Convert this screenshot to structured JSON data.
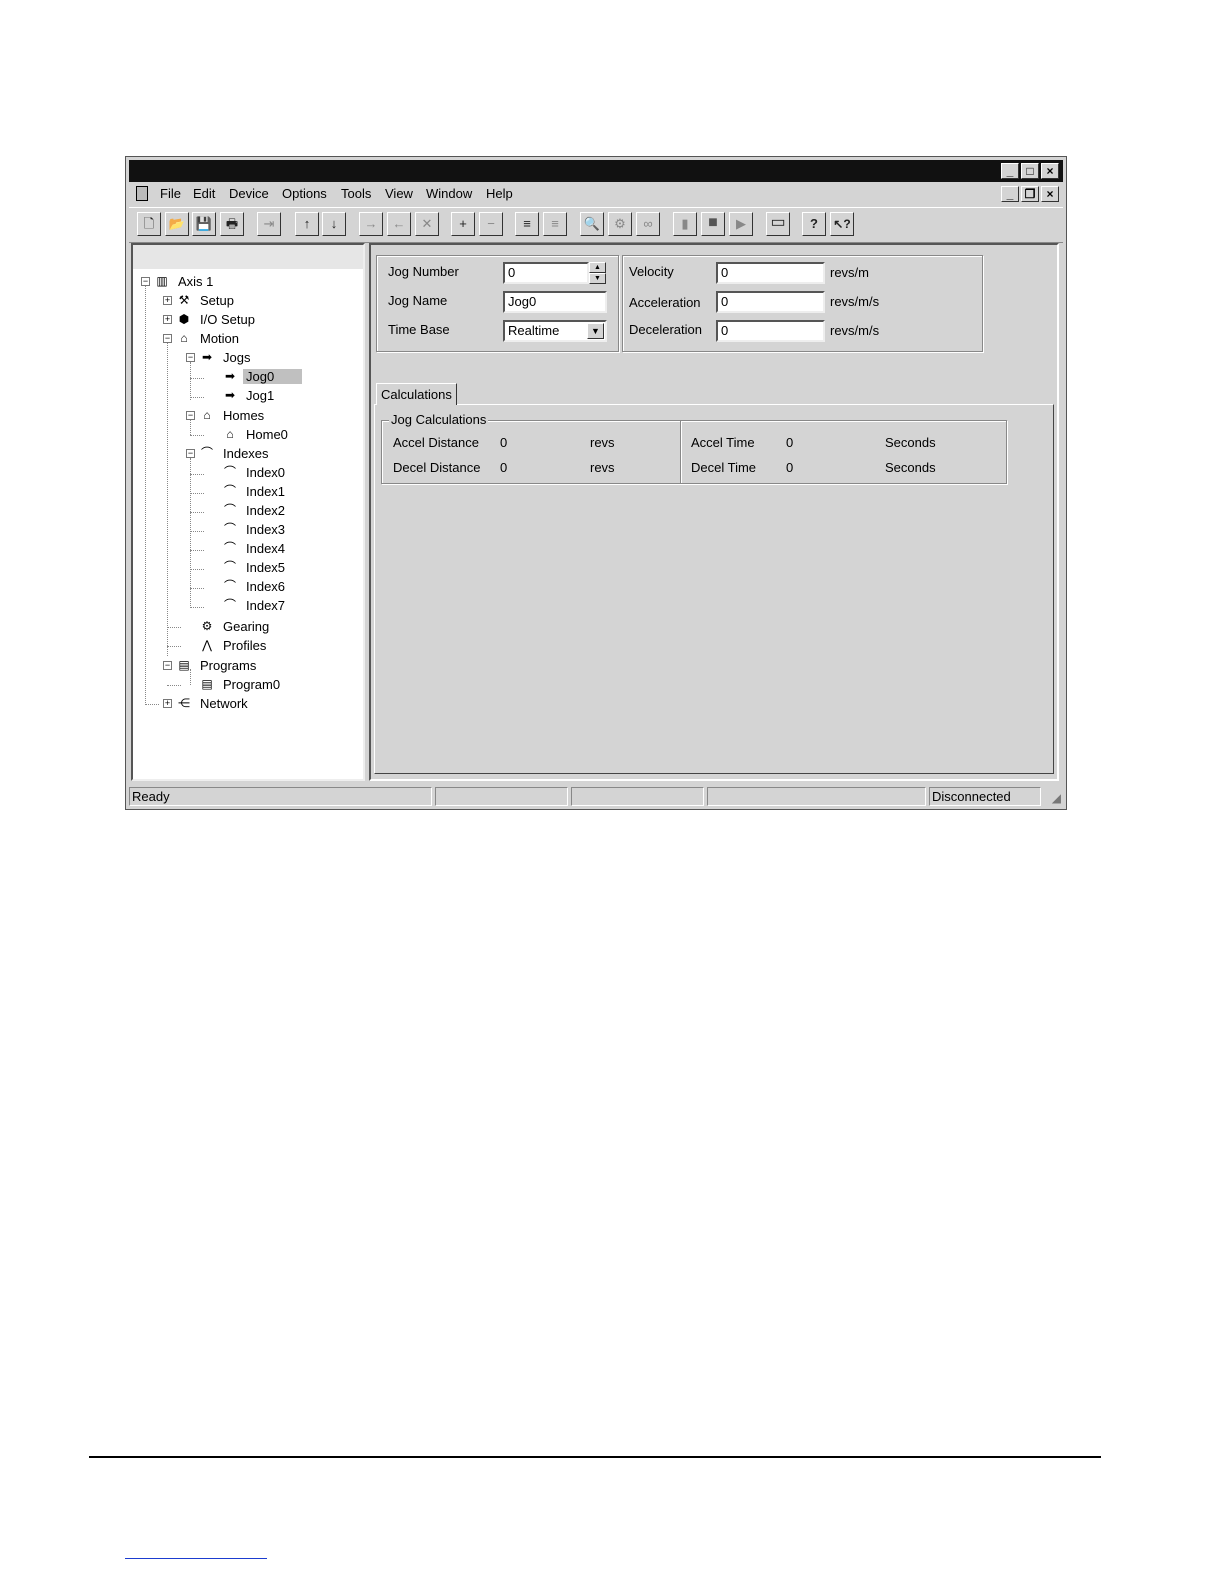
{
  "window": {
    "buttons": {
      "minimize": "_",
      "maximize": "□",
      "close": "×"
    },
    "mdi_buttons": {
      "minimize": "_",
      "restore": "❐",
      "close": "×"
    }
  },
  "menu": [
    "File",
    "Edit",
    "Device",
    "Options",
    "Tools",
    "View",
    "Window",
    "Help"
  ],
  "toolbar": [
    {
      "name": "new-icon",
      "glyph": "🗋"
    },
    {
      "name": "open-icon",
      "glyph": "📂"
    },
    {
      "name": "save-icon",
      "glyph": "💾"
    },
    {
      "name": "print-icon",
      "glyph": "🖶"
    },
    {
      "name": "import-icon",
      "glyph": "⇥"
    },
    {
      "name": "upload-icon",
      "glyph": "↑"
    },
    {
      "name": "download-icon",
      "glyph": "↓"
    },
    {
      "name": "connect-icon",
      "glyph": "→"
    },
    {
      "name": "disconnect-icon",
      "glyph": "←"
    },
    {
      "name": "cancel-icon",
      "glyph": "✕"
    },
    {
      "name": "add-node-icon",
      "glyph": "+"
    },
    {
      "name": "remove-node-icon",
      "glyph": "−"
    },
    {
      "name": "program-icon",
      "glyph": "≡"
    },
    {
      "name": "program-dim-icon",
      "glyph": "≡"
    },
    {
      "name": "zoom-icon",
      "glyph": "🔍"
    },
    {
      "name": "settings-icon",
      "glyph": "⚙"
    },
    {
      "name": "watch-icon",
      "glyph": "∞"
    },
    {
      "name": "enable-icon",
      "glyph": "▮"
    },
    {
      "name": "stop-icon",
      "glyph": "■"
    },
    {
      "name": "run-icon",
      "glyph": "▶"
    },
    {
      "name": "window-icon",
      "glyph": "▭"
    },
    {
      "name": "help-icon",
      "glyph": "?"
    },
    {
      "name": "context-help-icon",
      "glyph": "↖?"
    }
  ],
  "tree": {
    "axis": "Axis 1",
    "setup": "Setup",
    "io_setup": "I/O Setup",
    "motion": "Motion",
    "jogs": "Jogs",
    "jog0": "Jog0",
    "jog1": "Jog1",
    "homes": "Homes",
    "home0": "Home0",
    "indexes": "Indexes",
    "index_items": [
      "Index0",
      "Index1",
      "Index2",
      "Index3",
      "Index4",
      "Index5",
      "Index6",
      "Index7"
    ],
    "gearing": "Gearing",
    "profiles": "Profiles",
    "programs": "Programs",
    "program0": "Program0",
    "network": "Network",
    "expand_plus": "+",
    "expand_minus": "−"
  },
  "form": {
    "jog_number_label": "Jog Number",
    "jog_number_value": "0",
    "jog_name_label": "Jog Name",
    "jog_name_value": "Jog0",
    "time_base_label": "Time Base",
    "time_base_value": "Realtime",
    "velocity_label": "Velocity",
    "velocity_value": "0",
    "velocity_unit": "revs/m",
    "acceleration_label": "Acceleration",
    "acceleration_value": "0",
    "acceleration_unit": "revs/m/s",
    "deceleration_label": "Deceleration",
    "deceleration_value": "0",
    "deceleration_unit": "revs/m/s"
  },
  "tab": "Calculations",
  "calculations": {
    "group_title": "Jog Calculations",
    "accel_distance_label": "Accel Distance",
    "accel_distance_value": "0",
    "accel_distance_unit": "revs",
    "decel_distance_label": "Decel Distance",
    "decel_distance_value": "0",
    "decel_distance_unit": "revs",
    "accel_time_label": "Accel Time",
    "accel_time_value": "0",
    "accel_time_unit": "Seconds",
    "decel_time_label": "Decel Time",
    "decel_time_value": "0",
    "decel_time_unit": "Seconds"
  },
  "status": {
    "left": "Ready",
    "right": "Disconnected"
  }
}
